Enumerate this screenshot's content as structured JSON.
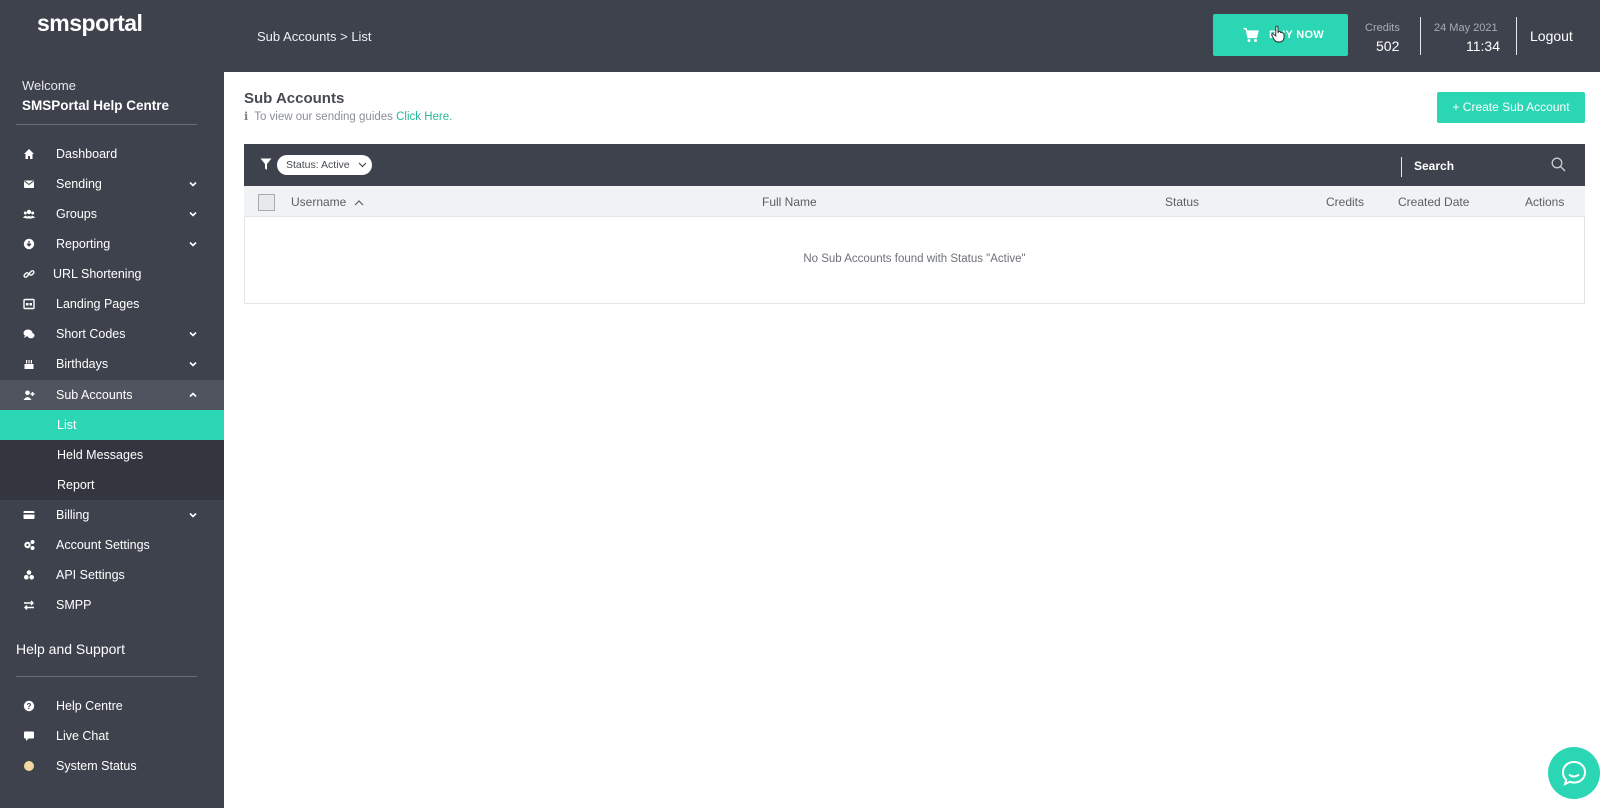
{
  "app": {
    "logo": "smsportal",
    "welcome": "Welcome",
    "account_name": "SMSPortal Help Centre"
  },
  "sidebar": {
    "items": [
      {
        "label": "Dashboard",
        "icon": "home-icon"
      },
      {
        "label": "Sending",
        "icon": "envelope-icon"
      },
      {
        "label": "Groups",
        "icon": "users-icon"
      },
      {
        "label": "Reporting",
        "icon": "download-circle-icon"
      },
      {
        "label": "URL Shortening",
        "icon": "link-icon"
      },
      {
        "label": "Landing Pages",
        "icon": "page-icon"
      },
      {
        "label": "Short Codes",
        "icon": "comments-icon"
      },
      {
        "label": "Birthdays",
        "icon": "cake-icon"
      },
      {
        "label": "Sub Accounts",
        "icon": "user-plus-icon"
      },
      {
        "label": "Billing",
        "icon": "credit-card-icon"
      },
      {
        "label": "Account Settings",
        "icon": "cogs-icon"
      },
      {
        "label": "API Settings",
        "icon": "api-icon"
      },
      {
        "label": "SMPP",
        "icon": "exchange-icon"
      }
    ],
    "sub_items": [
      {
        "label": "List"
      },
      {
        "label": "Held Messages"
      },
      {
        "label": "Report"
      }
    ],
    "help_title": "Help and Support",
    "help_items": [
      {
        "label": "Help Centre",
        "icon": "question-circle-icon"
      },
      {
        "label": "Live Chat",
        "icon": "chat-bubble-icon"
      },
      {
        "label": "System Status",
        "icon": "status-dot-icon"
      }
    ]
  },
  "topbar": {
    "breadcrumb": "Sub Accounts > List",
    "buy_now": "BUY NOW",
    "credits_label": "Credits",
    "credits_value": "502",
    "date": "24 May 2021",
    "time": "11:34",
    "logout": "Logout"
  },
  "main": {
    "title": "Sub Accounts",
    "guide_text": "To view our sending guides ",
    "guide_link": "Click Here.",
    "create_button": "+ Create Sub Account",
    "filter_status": "Status: Active",
    "search_placeholder": "Search",
    "columns": [
      "Username",
      "Full Name",
      "Status",
      "Credits",
      "Created Date",
      "Actions"
    ],
    "empty_message": "No Sub Accounts found with Status \"Active\""
  },
  "colors": {
    "accent": "#2ad6b4",
    "sidebar_bg": "#3e424d",
    "submenu_bg": "#33363f"
  }
}
